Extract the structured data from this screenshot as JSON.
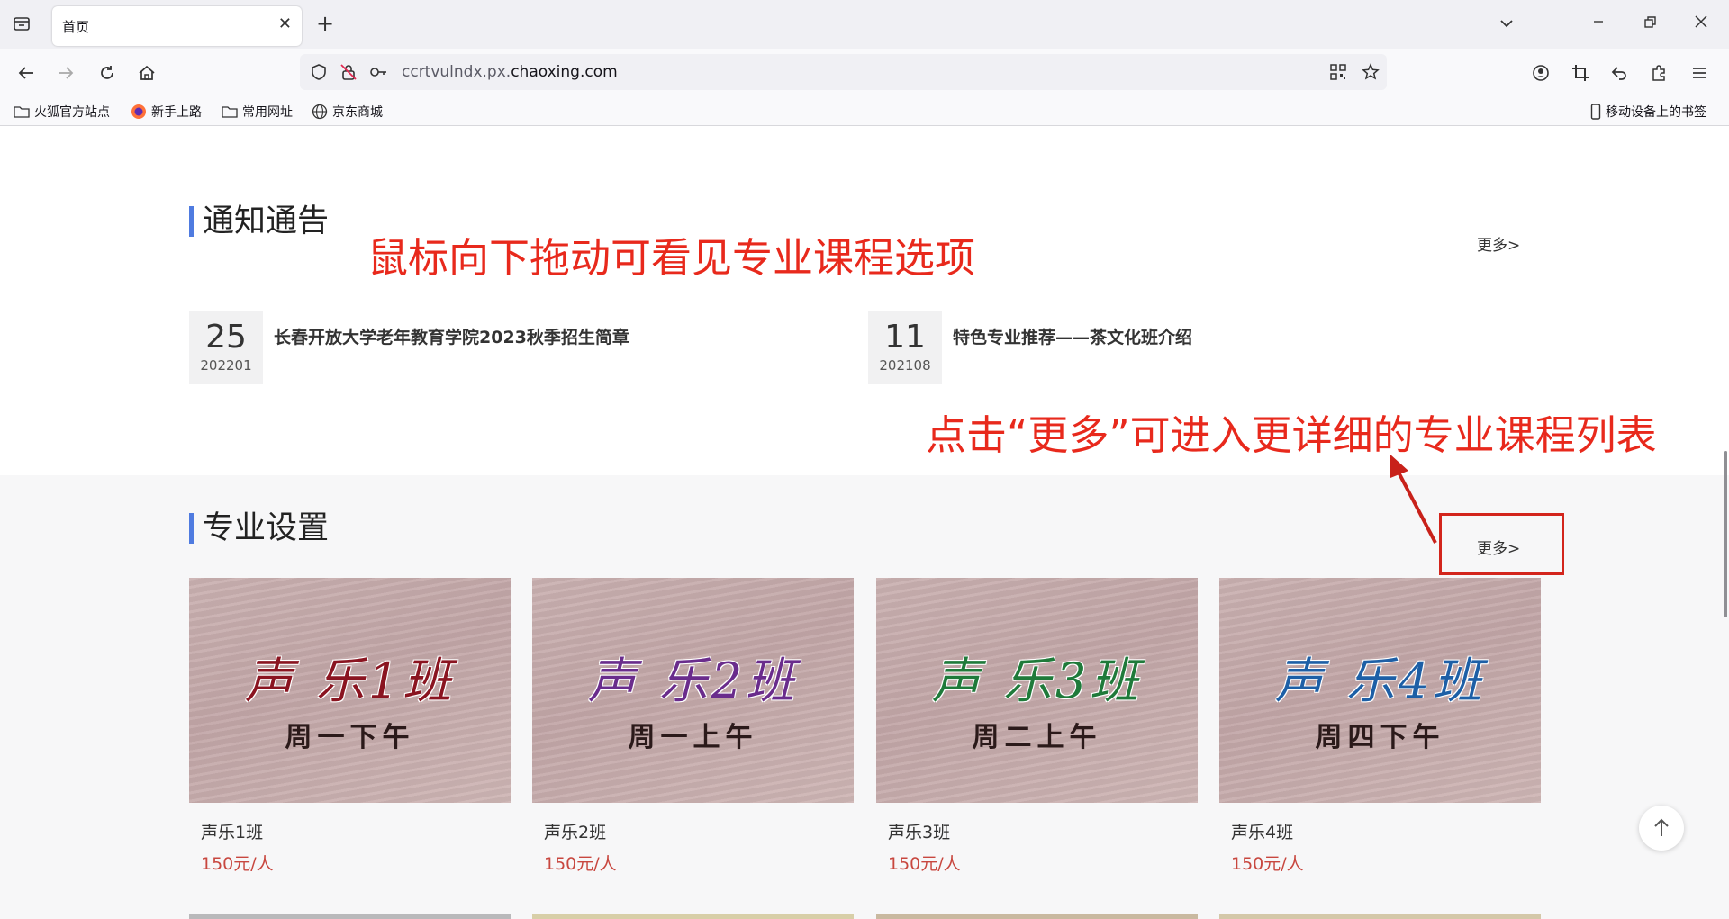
{
  "browser": {
    "tab_title": "首页",
    "url_host": "ccrtvulndx.px.",
    "url_domain": "chaoxing.com",
    "bookmarks": [
      "火狐官方站点",
      "新手上路",
      "常用网址",
      "京东商城"
    ],
    "mobile_bookmarks": "移动设备上的书签"
  },
  "notice": {
    "title": "通知通告",
    "more": "更多>",
    "items": [
      {
        "day": "25",
        "ym": "202201",
        "title": "长春开放大学老年教育学院2023秋季招生简章"
      },
      {
        "day": "11",
        "ym": "202108",
        "title": "特色专业推荐——茶文化班介绍"
      }
    ]
  },
  "annotations": {
    "scroll_hint": "鼠标向下拖动可看见专业课程选项",
    "more_hint": "点击“更多”可进入更详细的专业课程列表"
  },
  "majors": {
    "title": "专业设置",
    "more": "更多>",
    "cards": [
      {
        "name": "声乐1班",
        "price": "150元/人",
        "banner_main": "声 乐1班",
        "banner_sub": "周一下午",
        "color": "#8a1420"
      },
      {
        "name": "声乐2班",
        "price": "150元/人",
        "banner_main": "声 乐2班",
        "banner_sub": "周一上午",
        "color": "#6a2c8c"
      },
      {
        "name": "声乐3班",
        "price": "150元/人",
        "banner_main": "声 乐3班",
        "banner_sub": "周二上午",
        "color": "#1f7a3a"
      },
      {
        "name": "声乐4班",
        "price": "150元/人",
        "banner_main": "声 乐4班",
        "banner_sub": "周四下午",
        "color": "#1d5fa6"
      }
    ]
  },
  "colors": {
    "accent": "#4f7be0",
    "annotation": "#e8291c",
    "price": "#c8473f"
  }
}
